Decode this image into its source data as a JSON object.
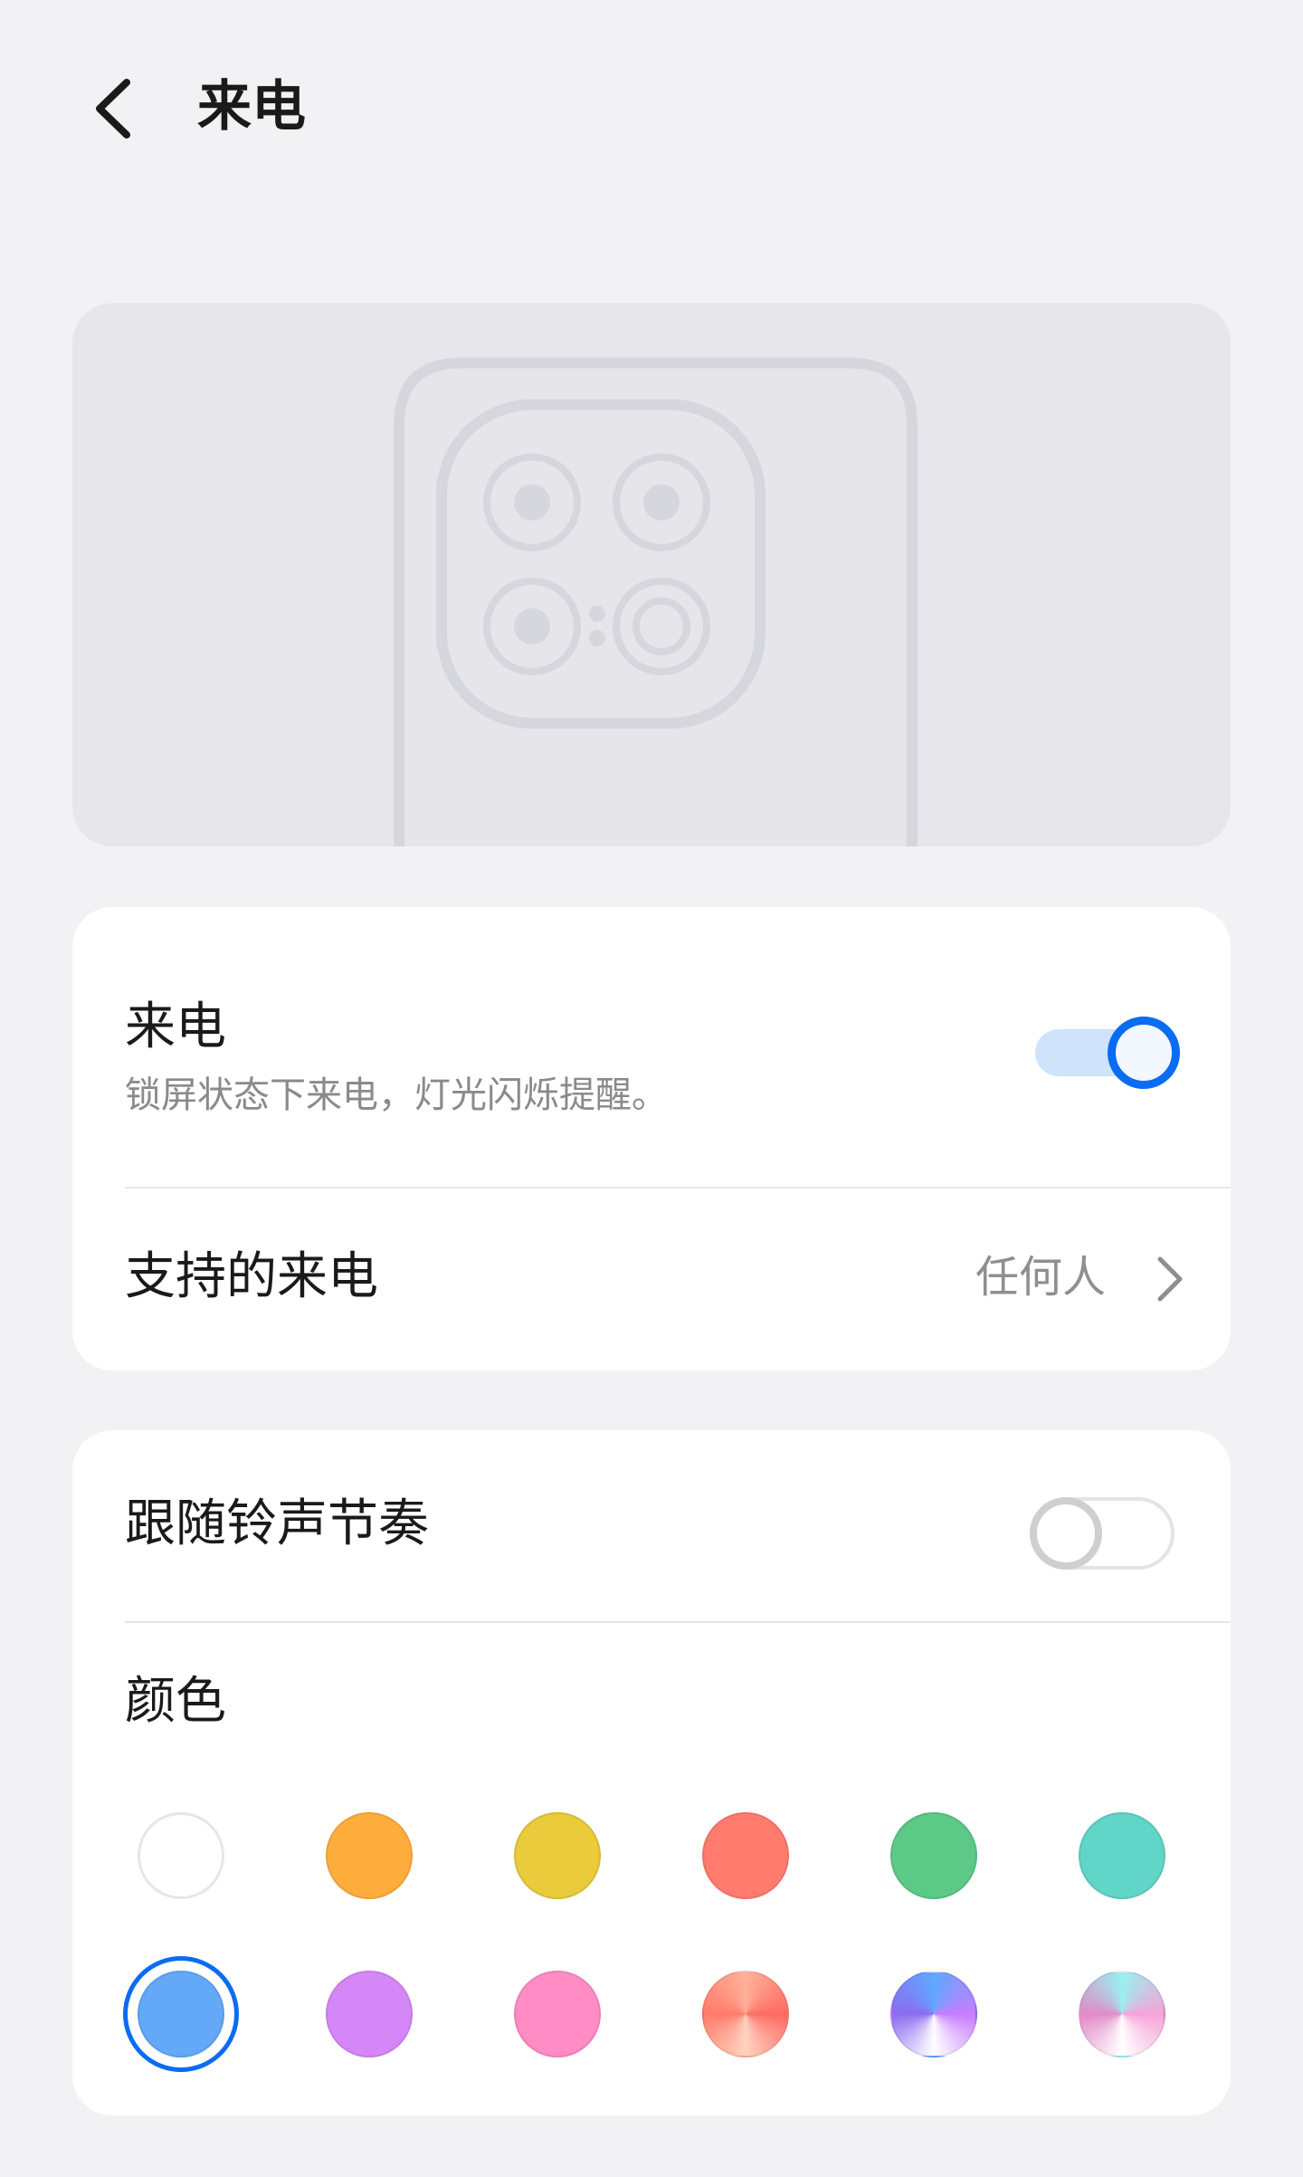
{
  "header": {
    "title": "来电",
    "back_icon": "chevron-left-icon"
  },
  "illustration": {
    "icon": "phone-camera-illustration"
  },
  "incoming_call": {
    "title": "来电",
    "subtitle": "锁屏状态下来电，灯光闪烁提醒。",
    "enabled": true
  },
  "supported_calls": {
    "title": "支持的来电",
    "value": "任何人",
    "chevron_icon": "chevron-right-icon"
  },
  "follow_rhythm": {
    "title": "跟随铃声节奏",
    "enabled": false
  },
  "color_section": {
    "title": "颜色",
    "selected_index": 6,
    "swatches": [
      {
        "name": "white",
        "color": "#FFFFFF"
      },
      {
        "name": "orange",
        "color": "#FFAE3D"
      },
      {
        "name": "yellow",
        "color": "#EACB3C"
      },
      {
        "name": "red",
        "color": "#FF7B6E"
      },
      {
        "name": "green",
        "color": "#5CC987"
      },
      {
        "name": "teal",
        "color": "#62D5C9"
      },
      {
        "name": "blue",
        "color": "#63A9F8"
      },
      {
        "name": "purple",
        "color": "#D587F7"
      },
      {
        "name": "pink",
        "color": "#FF8CC4"
      },
      {
        "name": "coral-gradient",
        "color": "#FF8E7C"
      },
      {
        "name": "violet-gradient",
        "color": "#A07CF2"
      },
      {
        "name": "rainbow-gradient",
        "color": "#E0A6D8"
      }
    ]
  },
  "colors": {
    "background": "#F2F2F4",
    "card": "#FFFFFF",
    "accent": "#0A6CF0",
    "secondary_text": "#8A8A8E"
  }
}
